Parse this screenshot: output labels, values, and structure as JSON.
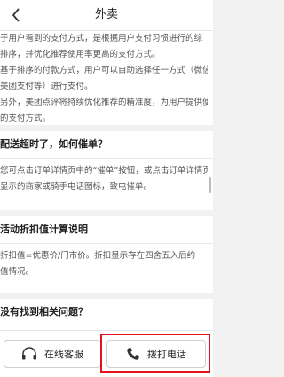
{
  "header": {
    "title": "外卖",
    "back_icon": "chevron-left-icon"
  },
  "cards": [
    {
      "lines": [
        "于用户看到的支付方式，是根据用户支付习惯进行的综",
        "排序，并优化推荐使用率更高的支付方式。",
        "基于排序的付款方式，用户可以自助选择任一方式（微信、",
        "美团支付等）进行支付。",
        "另外，美团点评将持续优化推荐的精准度，为用户提供便",
        "的支付方式。"
      ]
    },
    {
      "question": "配送超时了，如何催单？",
      "lines": [
        "您可点击订单详情页中的“催单”按钮，或点击订单详情页",
        "显示的商家或骑手电话图标，致电催单。"
      ]
    },
    {
      "question": "活动折扣值计算说明",
      "lines": [
        "折扣值=优惠价/门市价。折扣显示存在四舍五入后约",
        "值情况。"
      ]
    },
    {
      "question": "没有找到相关问题？",
      "lines": []
    }
  ],
  "footer": {
    "online_service_label": "在线客服",
    "online_service_icon": "headset-icon",
    "call_label": "拨打电话",
    "call_icon": "phone-icon",
    "highlight_color": "#e0131d"
  }
}
